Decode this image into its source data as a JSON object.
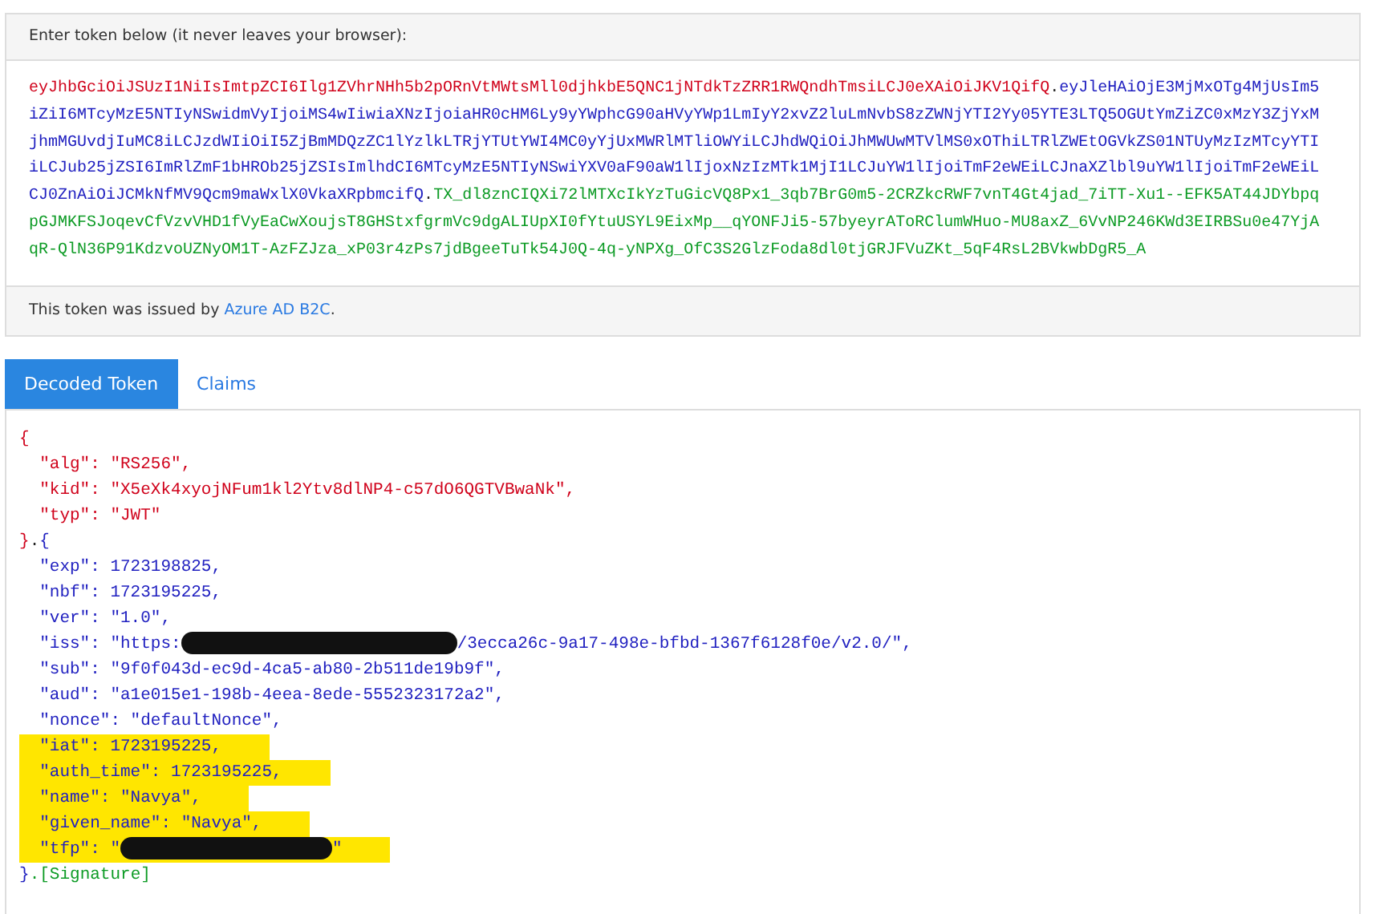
{
  "token_panel": {
    "heading": "Enter token below (it never leaves your browser):",
    "lines": [
      [
        {
          "kind": "header",
          "text": "eyJhbGciOiJSUzI1NiIsImtpZCI6Ilg1ZVhrNHh5b2pORnVtMWtsMll0djhkbE5QNC1jNTdkTzZRR1RWQndhTmsiLCJ0eXAiOiJKV1QifQ"
        },
        {
          "kind": "dot",
          "text": "."
        },
        {
          "kind": "payload",
          "text": "eyJleHAiOjE3MjMxOTg4MjUsIm5"
        }
      ],
      [
        {
          "kind": "payload",
          "text": "iZiI6MTcyMzE5NTIyNSwidmVyIjoiMS4wIiwiaXNzIjoiaHR0cHM6Ly9yYWphcG90aHVyYWp1LmIyY2xvZ2luLmNvbS8zZWNjYTI2Yy05YTE3LTQ5OGUtYmZiZC0xMzY3ZjYxM"
        }
      ],
      [
        {
          "kind": "payload",
          "text": "jhmMGUvdjIuMC8iLCJzdWIiOiI5ZjBmMDQzZC1lYzlkLTRjYTUtYWI4MC0yYjUxMWRlMTliOWYiLCJhdWQiOiJhMWUwMTVlMS0xOThiLTRlZWEtOGVkZS01NTUyMzIzMTcyYTI"
        }
      ],
      [
        {
          "kind": "payload",
          "text": "iLCJub25jZSI6ImRlZmF1bHROb25jZSIsImlhdCI6MTcyMzE5NTIyNSwiYXV0aF90aW1lIjoxNzIzMTk1MjI1LCJuYW1lIjoiTmF2eWEiLCJnaXZlbl9uYW1lIjoiTmF2eWEiL"
        }
      ],
      [
        {
          "kind": "payload",
          "text": "CJ0ZnAiOiJCMkNfMV9Qcm9maWxlX0VkaXRpbmcifQ"
        },
        {
          "kind": "dot",
          "text": "."
        },
        {
          "kind": "signature",
          "text": "TX_dl8znCIQXi72lMTXcIkYzTuGicVQ8Px1_3qb7BrG0m5-2CRZkcRWF7vnT4Gt4jad_7iTT-Xu1--EFK5AT44JDYbpq"
        }
      ],
      [
        {
          "kind": "signature",
          "text": "pGJMKFSJoqevCfVzvVHD1fVyEaCwXoujsT8GHStxfgrmVc9dgALIUpXI0fYtuUSYL9EixMp__qYONFJi5-57byeyrAToRClumWHuo-MU8axZ_6VvNP246KWd3EIRBSu0e47YjA"
        }
      ],
      [
        {
          "kind": "signature",
          "text": "qR-QlN36P91KdzvoUZNyOM1T-AzFZJza_xP03r4zPs7jdBgeeTuTk54J0Q-4q-yNPXg_OfC3S2GlzFoda8dl0tjGRJFVuZKt_5qF4RsL2BVkwbDgR5_A"
        }
      ]
    ],
    "issuer_note": {
      "text": "This token was issued by ",
      "link": "Azure AD B2C",
      "end": "."
    }
  },
  "tabs": [
    {
      "label": "Decoded Token",
      "selected": true
    },
    {
      "label": "Claims",
      "selected": false
    }
  ],
  "decoded": [
    {
      "highlighted": false,
      "segments": [
        {
          "kind": "header",
          "text": "{"
        }
      ]
    },
    {
      "highlighted": false,
      "segments": [
        {
          "kind": "header",
          "text": "  \"alg\": \"RS256\","
        }
      ]
    },
    {
      "highlighted": false,
      "segments": [
        {
          "kind": "header",
          "text": "  \"kid\": \"X5eXk4xyojNFum1kl2Ytv8dlNP4-c57dO6QGTVBwaNk\","
        }
      ]
    },
    {
      "highlighted": false,
      "segments": [
        {
          "kind": "header",
          "text": "  \"typ\": \"JWT\""
        }
      ]
    },
    {
      "highlighted": false,
      "segments": [
        {
          "kind": "header",
          "text": "}"
        },
        {
          "kind": "dot",
          "text": "."
        },
        {
          "kind": "payload",
          "text": "{"
        }
      ]
    },
    {
      "highlighted": false,
      "segments": [
        {
          "kind": "payload",
          "text": "  \"exp\": 1723198825,"
        }
      ]
    },
    {
      "highlighted": false,
      "segments": [
        {
          "kind": "payload",
          "text": "  \"nbf\": 1723195225,"
        }
      ]
    },
    {
      "highlighted": false,
      "segments": [
        {
          "kind": "payload",
          "text": "  \"ver\": \"1.0\","
        }
      ]
    },
    {
      "highlighted": false,
      "segments": [
        {
          "kind": "payload",
          "text": "  \"iss\": \"https:"
        },
        {
          "kind": "long-redaction"
        },
        {
          "kind": "payload",
          "text": "/3ecca26c-9a17-498e-bfbd-1367f6128f0e/v2.0/\","
        }
      ]
    },
    {
      "highlighted": false,
      "segments": [
        {
          "kind": "payload",
          "text": "  \"sub\": \"9f0f043d-ec9d-4ca5-ab80-2b511de19b9f\","
        }
      ]
    },
    {
      "highlighted": false,
      "segments": [
        {
          "kind": "payload",
          "text": "  \"aud\": \"a1e015e1-198b-4eea-8ede-5552323172a2\","
        }
      ]
    },
    {
      "highlighted": false,
      "segments": [
        {
          "kind": "payload",
          "text": "  \"nonce\": \"defaultNonce\","
        }
      ]
    },
    {
      "highlighted": true,
      "segments": [
        {
          "kind": "payload",
          "text": "  \"iat\": 1723195225,"
        }
      ]
    },
    {
      "highlighted": true,
      "segments": [
        {
          "kind": "payload",
          "text": "  \"auth_time\": 1723195225,"
        }
      ]
    },
    {
      "highlighted": true,
      "segments": [
        {
          "kind": "payload",
          "text": "  \"name\": \"Navya\","
        }
      ]
    },
    {
      "highlighted": true,
      "segments": [
        {
          "kind": "payload",
          "text": "  \"given_name\": \"Navya\","
        }
      ]
    },
    {
      "highlighted": true,
      "segments": [
        {
          "kind": "payload",
          "text": "  \"tfp\": \""
        },
        {
          "kind": "short-redaction"
        },
        {
          "kind": "payload",
          "text": "\""
        }
      ]
    },
    {
      "highlighted": false,
      "segments": [
        {
          "kind": "payload",
          "text": "}"
        },
        {
          "kind": "signature",
          "text": ".[Signature]"
        }
      ]
    }
  ]
}
